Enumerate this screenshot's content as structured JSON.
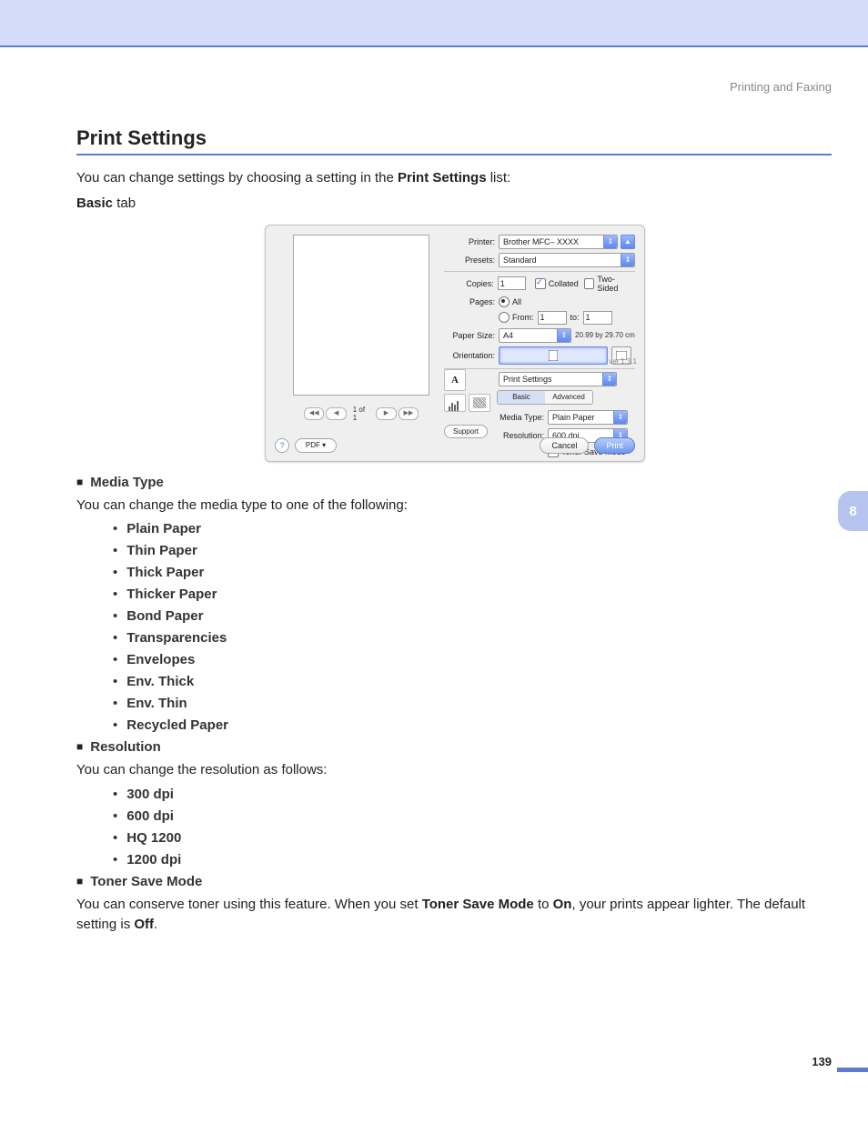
{
  "breadcrumb": "Printing and Faxing",
  "chapter_tab": "8",
  "page_number": "139",
  "heading": "Print Settings",
  "intro_pre": "You can change settings by choosing a setting in the ",
  "intro_bold": "Print Settings",
  "intro_post": " list:",
  "basic_tab_label_bold": "Basic",
  "basic_tab_label_post": " tab",
  "dialog": {
    "printer_label": "Printer:",
    "printer_value": "Brother MFC– XXXX",
    "presets_label": "Presets:",
    "presets_value": "Standard",
    "copies_label": "Copies:",
    "copies_value": "1",
    "collated_label": "Collated",
    "twosided_label": "Two-Sided",
    "pages_label": "Pages:",
    "pages_all": "All",
    "pages_from": "From:",
    "pages_to": "to:",
    "from_value": "1",
    "to_value": "1",
    "papersize_label": "Paper Size:",
    "papersize_value": "A4",
    "papersize_dims": "20.99 by 29.70 cm",
    "orientation_label": "Orientation:",
    "panel_name": "Print Settings",
    "version": "ver.1.3.1",
    "tab_basic": "Basic",
    "tab_advanced": "Advanced",
    "media_label": "Media Type:",
    "media_value": "Plain Paper",
    "res_label": "Resolution:",
    "res_value": "600 dpi",
    "tonersave_label": "Toner Save Mode",
    "support_btn": "Support",
    "nav_label": "1 of 1",
    "help": "?",
    "pdf": "PDF ▾",
    "cancel": "Cancel",
    "print": "Print"
  },
  "sec_media": {
    "title": "Media Type",
    "desc": "You can change the media type to one of the following:",
    "items": [
      "Plain Paper",
      "Thin Paper",
      "Thick Paper",
      "Thicker Paper",
      "Bond Paper",
      "Transparencies",
      "Envelopes",
      "Env. Thick",
      "Env. Thin",
      "Recycled Paper"
    ]
  },
  "sec_res": {
    "title": "Resolution",
    "desc": "You can change the resolution as follows:",
    "items": [
      "300 dpi",
      "600 dpi",
      "HQ 1200",
      "1200 dpi"
    ]
  },
  "sec_toner": {
    "title": "Toner Save Mode",
    "p1": "You can conserve toner using this feature. When you set ",
    "p2": "Toner Save Mode",
    "p3": " to ",
    "p4": "On",
    "p5": ", your prints appear lighter. The default setting is ",
    "p6": "Off",
    "p7": "."
  }
}
